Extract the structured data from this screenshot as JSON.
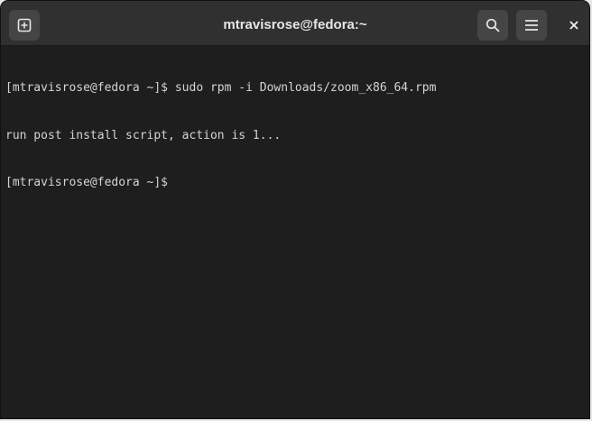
{
  "window": {
    "title": "mtravisrose@fedora:~"
  },
  "toolbar": {
    "new_tab_icon": "new-tab-icon",
    "search_icon": "search-icon",
    "menu_icon": "hamburger-menu-icon",
    "close_icon": "close-icon"
  },
  "terminal": {
    "lines": [
      "[mtravisrose@fedora ~]$ sudo rpm -i Downloads/zoom_x86_64.rpm",
      "run post install script, action is 1...",
      "[mtravisrose@fedora ~]$ "
    ]
  },
  "colors": {
    "titlebar": "#303030",
    "terminal_bg": "#1e1e1e",
    "terminal_fg": "#d4d4d4",
    "button_bg": "#454545"
  }
}
